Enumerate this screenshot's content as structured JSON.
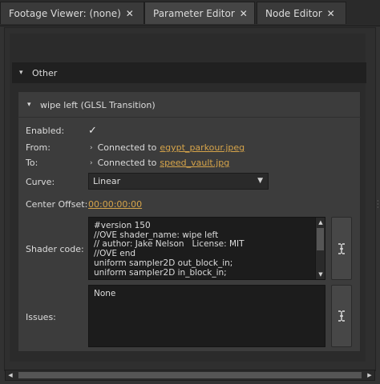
{
  "tabs": [
    {
      "label": "Footage Viewer: (none)"
    },
    {
      "label": "Parameter Editor"
    },
    {
      "label": "Node Editor"
    }
  ],
  "group": {
    "title": "Other"
  },
  "node": {
    "title": "wipe left (GLSL Transition)"
  },
  "fields": {
    "enabled_label": "Enabled:",
    "enabled_value": "✓",
    "from_label": "From:",
    "from_prefix": "Connected to",
    "from_link": "egypt_parkour.jpeg",
    "to_label": "To:",
    "to_prefix": "Connected to",
    "to_link": "speed_vault.jpg",
    "curve_label": "Curve:",
    "curve_value": "Linear",
    "center_offset_label": "Center Offset:",
    "center_offset_value": "00:00:00:00",
    "shader_label": "Shader code:",
    "shader_code": "#version 150\n//OVE shader_name: wipe left\n// author: Jake Nelson   License: MIT\n//OVE end\nuniform sampler2D out_block_in;\nuniform sampler2D in_block_in;",
    "issues_label": "Issues:",
    "issues_value": "None"
  },
  "icons": {
    "pin": "pin-icon",
    "chevron": "chevron-down-icon",
    "arrow": "chevron-right-icon",
    "text_cursor": "text-cursor-icon"
  },
  "colors": {
    "link": "#d6a44a",
    "background": "#323232",
    "header": "#202020",
    "card": "#3c3c3c"
  }
}
